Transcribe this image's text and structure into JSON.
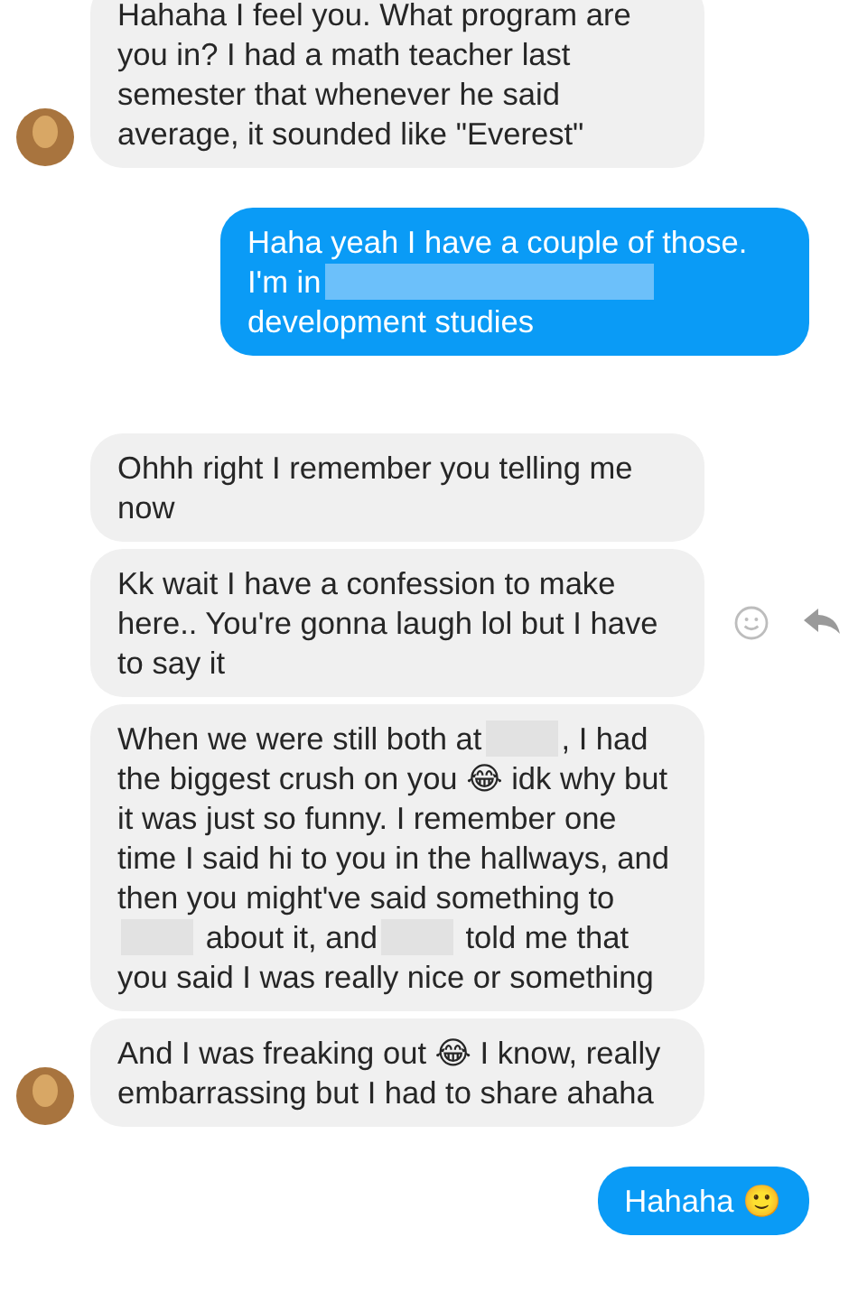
{
  "messages": [
    {
      "kind": "received",
      "avatar": true,
      "parts": [
        {
          "kind": "text",
          "text": "Hahaha I feel you. What program are you in? I had a math teacher last semester that whenever he said average, it sounded like \"Everest\""
        }
      ]
    },
    {
      "kind": "sent",
      "parts": [
        {
          "kind": "text",
          "text": "Haha yeah I have a couple of those. I'm in"
        },
        {
          "kind": "redacted"
        },
        {
          "kind": "text",
          "text": "development studies"
        }
      ]
    },
    {
      "kind": "received",
      "parts": [
        {
          "kind": "text",
          "text": "Ohhh right I remember you telling me now"
        }
      ]
    },
    {
      "kind": "received",
      "actions_shown": true,
      "parts": [
        {
          "kind": "text",
          "text": "Kk wait I have a confession to make here.. You're gonna laugh lol but I have to say it"
        }
      ]
    },
    {
      "kind": "received",
      "parts": [
        {
          "kind": "text",
          "text": "When we were still both at"
        },
        {
          "kind": "redacted"
        },
        {
          "kind": "text",
          "text": ", I had the biggest crush on you 😂 idk why but it was just so funny. I remember one time I said hi to you in the hallways, and then you might've said something to"
        },
        {
          "kind": "redacted"
        },
        {
          "kind": "text",
          "text": "about it, and"
        },
        {
          "kind": "redacted"
        },
        {
          "kind": "text",
          "text": "told me that you said I was really nice or something"
        }
      ]
    },
    {
      "kind": "received",
      "avatar": true,
      "parts": [
        {
          "kind": "text",
          "text": "And I was freaking out 😂 I know, really embarrassing but I had to share ahaha"
        }
      ]
    },
    {
      "kind": "sent",
      "parts": [
        {
          "kind": "text",
          "text": "Hahaha 🙂"
        }
      ]
    }
  ]
}
